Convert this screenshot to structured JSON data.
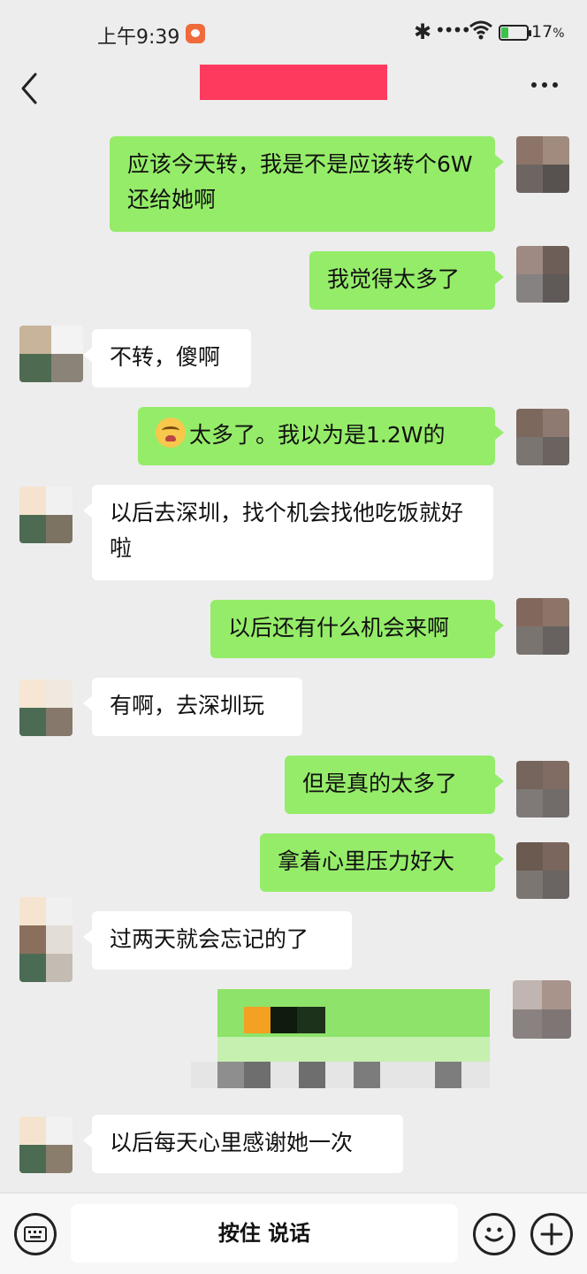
{
  "status_bar": {
    "time": "上午9:39",
    "battery_percent": "17",
    "battery_unit": "%",
    "bluetooth_icon": "bluetooth-icon",
    "wifi_icon": "wifi-icon"
  },
  "header": {
    "back_icon": "chevron-left-icon",
    "more_icon": "more-dots-icon"
  },
  "messages": [
    {
      "sender": "me",
      "text": "应该今天转，我是不是应该转个6W还给她啊"
    },
    {
      "sender": "me",
      "text": "我觉得太多了"
    },
    {
      "sender": "other",
      "text": "不转，傻啊"
    },
    {
      "sender": "me",
      "emoji": "crying-face",
      "text": "太多了。我以为是1.2W的"
    },
    {
      "sender": "other",
      "text": "以后去深圳，找个机会找他吃饭就好啦"
    },
    {
      "sender": "me",
      "text": "以后还有什么机会来啊"
    },
    {
      "sender": "other",
      "text": "有啊，去深圳玩"
    },
    {
      "sender": "me",
      "text": "但是真的太多了"
    },
    {
      "sender": "me",
      "text": "拿着心里压力好大"
    },
    {
      "sender": "other",
      "text": "过两天就会忘记的了"
    },
    {
      "sender": "me",
      "type": "redacted-card"
    },
    {
      "sender": "other",
      "text": "以后每天心里感谢她一次"
    }
  ],
  "bottom_bar": {
    "voice_label": "按住 说话",
    "keyboard_icon": "keyboard-icon",
    "emoji_icon": "smiley-icon",
    "plus_icon": "plus-icon"
  },
  "colors": {
    "my_bubble": "#95ec69",
    "other_bubble": "#ffffff",
    "background": "#ededed",
    "redaction": "#fe3b5e"
  }
}
